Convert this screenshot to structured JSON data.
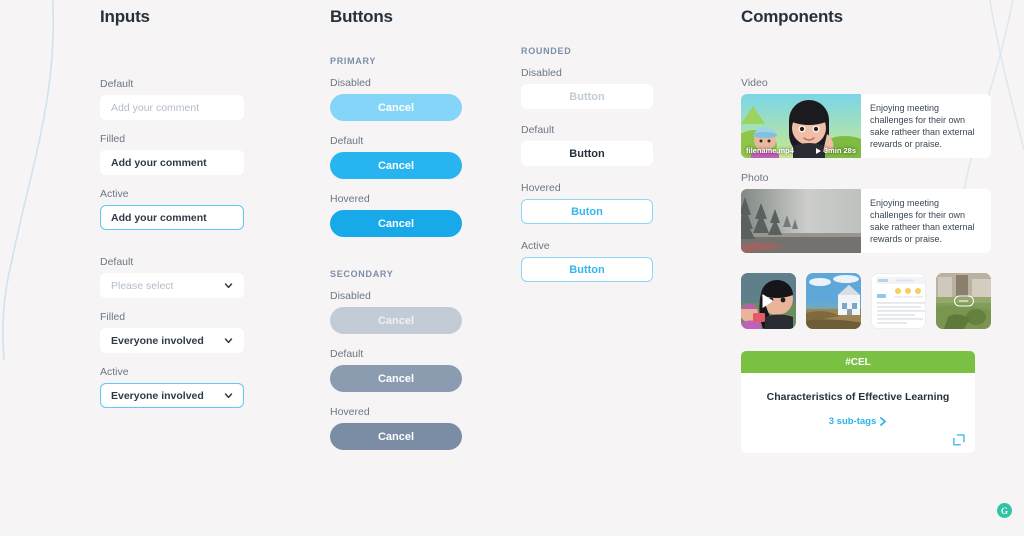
{
  "sections": {
    "inputs_title": "Inputs",
    "buttons_title": "Buttons",
    "components_title": "Components"
  },
  "inputs": {
    "fields": [
      {
        "label": "Default",
        "value": "Add your comment",
        "state": "placeholder"
      },
      {
        "label": "Filled",
        "value": "Add your comment",
        "state": "filled"
      },
      {
        "label": "Active",
        "value": "Add your comment",
        "state": "active"
      }
    ],
    "selects": [
      {
        "label": "Default",
        "value": "Please select",
        "state": "placeholder"
      },
      {
        "label": "Filled",
        "value": "Everyone involved",
        "state": "filled"
      },
      {
        "label": "Active",
        "value": "Everyone involved",
        "state": "active"
      }
    ]
  },
  "buttons": {
    "primary_group": "PRIMARY",
    "secondary_group": "SECONDARY",
    "rounded_group": "ROUNDED",
    "primary": [
      {
        "label": "Disabled",
        "text": "Cancel"
      },
      {
        "label": "Default",
        "text": "Cancel"
      },
      {
        "label": "Hovered",
        "text": "Cancel"
      }
    ],
    "secondary": [
      {
        "label": "Disabled",
        "text": "Cancel"
      },
      {
        "label": "Default",
        "text": "Cancel"
      },
      {
        "label": "Hovered",
        "text": "Cancel"
      }
    ],
    "rounded": [
      {
        "label": "Disabled",
        "text": "Button"
      },
      {
        "label": "Default",
        "text": "Button"
      },
      {
        "label": "Hovered",
        "text": "Buton"
      },
      {
        "label": "Active",
        "text": "Button"
      }
    ]
  },
  "components": {
    "video_label": "Video",
    "photo_label": "Photo",
    "video_card": {
      "filename": "filename.mp4",
      "duration": "3min 28s",
      "description": "Enjoying meeting challenges for their own sake ratheer than external rewards or praise."
    },
    "photo_card": {
      "description": "Enjoying meeting challenges for their own sake ratheer than external rewards or praise."
    },
    "thumbnails": [
      {
        "kind": "video"
      },
      {
        "kind": "photo"
      },
      {
        "kind": "document"
      },
      {
        "kind": "link"
      }
    ],
    "tag_card": {
      "tag": "#CEL",
      "title": "Characteristics of Effective Learning",
      "subtags": "3 sub-tags"
    }
  },
  "widget": {
    "glyph": "G"
  },
  "colors": {
    "background": "#f7f4f5",
    "primary_blue": "#27b4ef",
    "secondary_grey": "#8b9cb0",
    "tag_green": "#79c043",
    "widget_teal": "#2ec4a6"
  }
}
